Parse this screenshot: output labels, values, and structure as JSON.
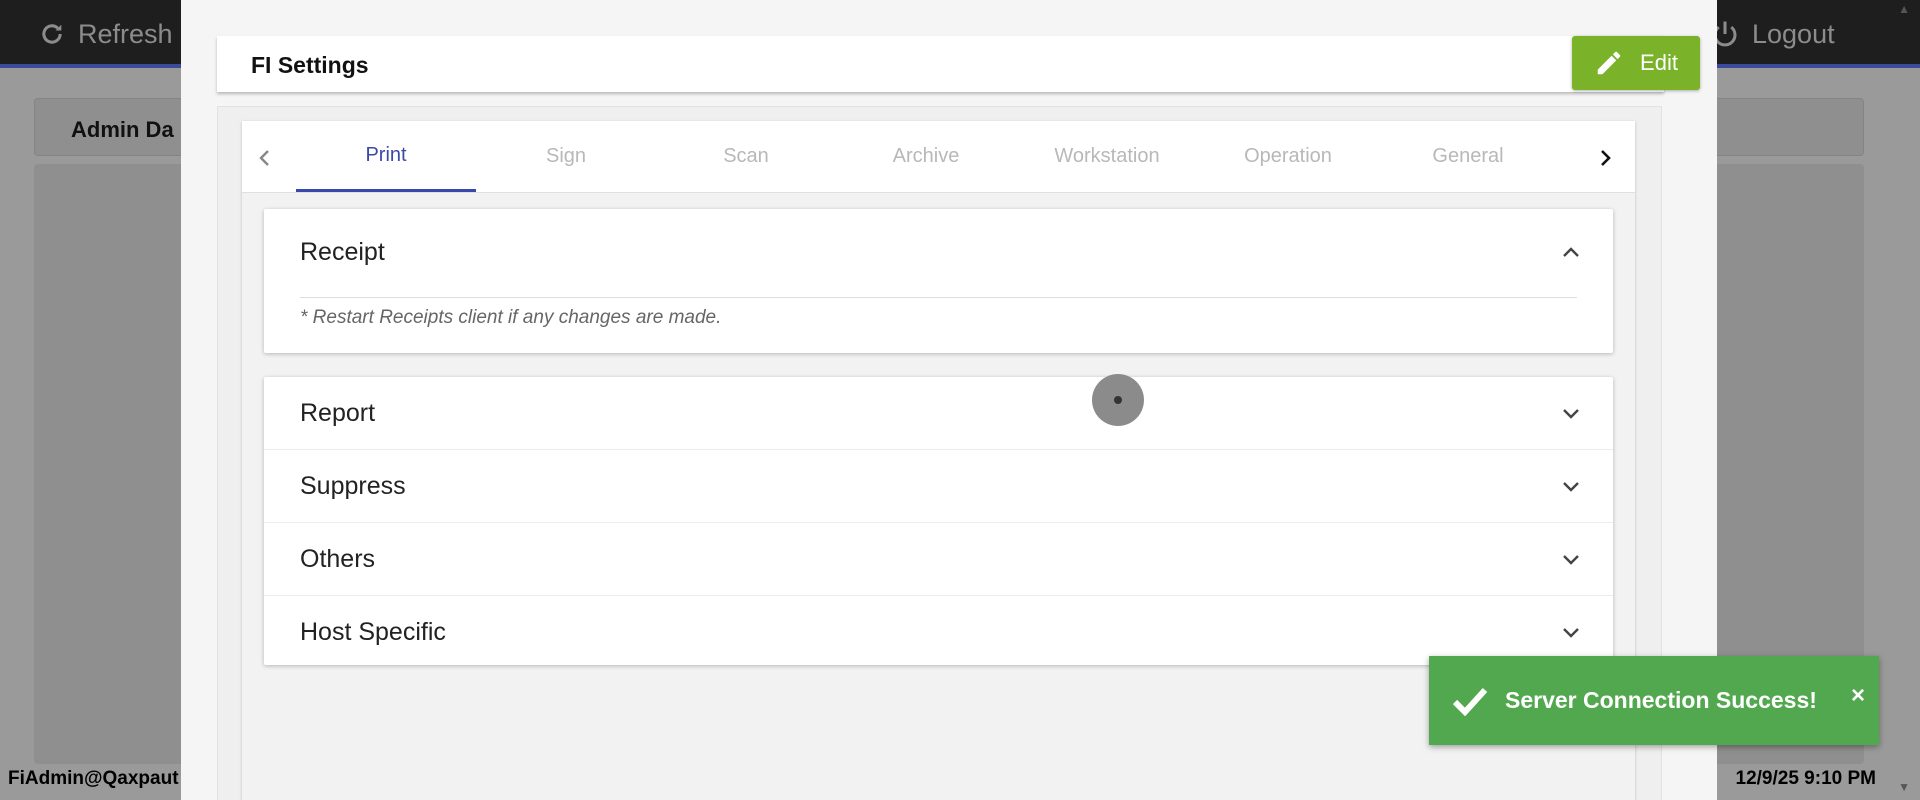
{
  "app": {
    "refresh_label": "Refresh",
    "logout_label": "Logout",
    "dashboard_title": "Admin Da",
    "footer_user": "FiAdmin@Qaxpaut",
    "footer_datetime": "12/9/25 9:10 PM"
  },
  "modal": {
    "title": "FI Settings",
    "edit_label": "Edit",
    "tabs": [
      {
        "label": "Print",
        "active": true
      },
      {
        "label": "Sign",
        "active": false
      },
      {
        "label": "Scan",
        "active": false
      },
      {
        "label": "Archive",
        "active": false
      },
      {
        "label": "Workstation",
        "active": false
      },
      {
        "label": "Operation",
        "active": false
      },
      {
        "label": "General",
        "active": false
      }
    ],
    "receipt": {
      "title": "Receipt",
      "note": "* Restart Receipts client if any changes are made."
    },
    "sections": [
      {
        "title": "Report"
      },
      {
        "title": "Suppress"
      },
      {
        "title": "Others"
      },
      {
        "title": "Host Specific"
      }
    ]
  },
  "toast": {
    "message": "Server Connection Success!",
    "close_symbol": "×"
  },
  "colors": {
    "accent": "#3949ab",
    "edit_button": "#7ab32a",
    "toast_success": "#52a84f",
    "topbar": "#1e1e1e"
  },
  "icons": {
    "refresh": "refresh-icon",
    "logout": "power-icon",
    "edit": "pencil-icon",
    "tab_prev": "chevron-left-icon",
    "tab_next": "chevron-right-icon",
    "expanded": "chevron-up-icon",
    "collapsed": "chevron-down-icon",
    "toast": "check-icon"
  }
}
